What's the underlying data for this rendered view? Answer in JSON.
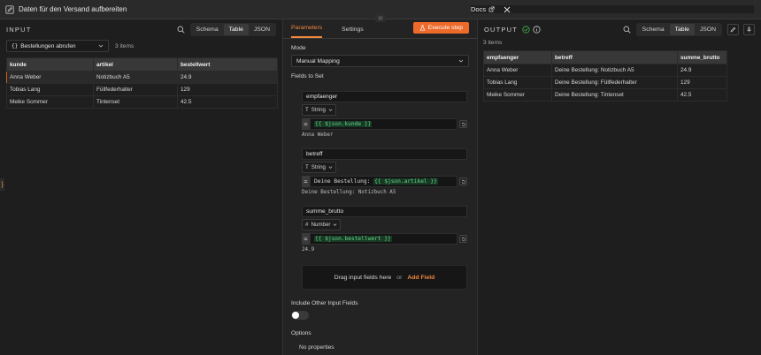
{
  "window": {
    "title": "Daten für den Versand aufbereiten",
    "docs_label": "Docs"
  },
  "input": {
    "title": "INPUT",
    "views": [
      "Schema",
      "Table",
      "JSON"
    ],
    "active_view": "Table",
    "node_select": "Bestellungen abrufen",
    "count": "3 items",
    "columns": [
      "kunde",
      "artikel",
      "bestellwert"
    ],
    "rows": [
      [
        "Anna Weber",
        "Notizbuch A5",
        "24.9"
      ],
      [
        "Tobias Lang",
        "Füllfederhalter",
        "129"
      ],
      [
        "Meike Sommer",
        "Tintenset",
        "42.5"
      ]
    ]
  },
  "params": {
    "tabs": [
      "Parameters",
      "Settings"
    ],
    "active_tab": "Parameters",
    "execute_label": "Execute step",
    "mode_label": "Mode",
    "mode_value": "Manual Mapping",
    "fields_label": "Fields to Set",
    "fields": [
      {
        "name": "empfaenger",
        "type": "String",
        "type_icon": "T",
        "prefix": "",
        "expr": "{{ $json.kunde }}",
        "preview": "Anna Weber"
      },
      {
        "name": "betreff",
        "type": "String",
        "type_icon": "T",
        "prefix": "Deine Bestellung: ",
        "expr": "{{ $json.artikel }}",
        "preview": "Deine Bestellung: Notizbuch A5"
      },
      {
        "name": "summe_brutto",
        "type": "Number",
        "type_icon": "#",
        "prefix": "",
        "expr": "{{ $json.bestellwert }}",
        "preview": "24.9"
      }
    ],
    "drop_text": "Drag input fields here",
    "drop_or": "or",
    "add_field": "Add Field",
    "include_label": "Include Other Input Fields",
    "options_label": "Options",
    "no_properties": "No properties"
  },
  "output": {
    "title": "OUTPUT",
    "views": [
      "Schema",
      "Table",
      "JSON"
    ],
    "active_view": "Table",
    "count": "3 items",
    "columns": [
      "empfaenger",
      "betreff",
      "summe_brutto"
    ],
    "rows": [
      [
        "Anna Weber",
        "Deine Bestellung: Notizbuch A5",
        "24.9"
      ],
      [
        "Tobias Lang",
        "Deine Bestellung: Füllfederhalter",
        "129"
      ],
      [
        "Meike Sommer",
        "Deine Bestellung: Tintenset",
        "42.5"
      ]
    ]
  },
  "colors": {
    "accent": "#ee6a2a",
    "success": "#3fb950",
    "token": "#63d287"
  }
}
